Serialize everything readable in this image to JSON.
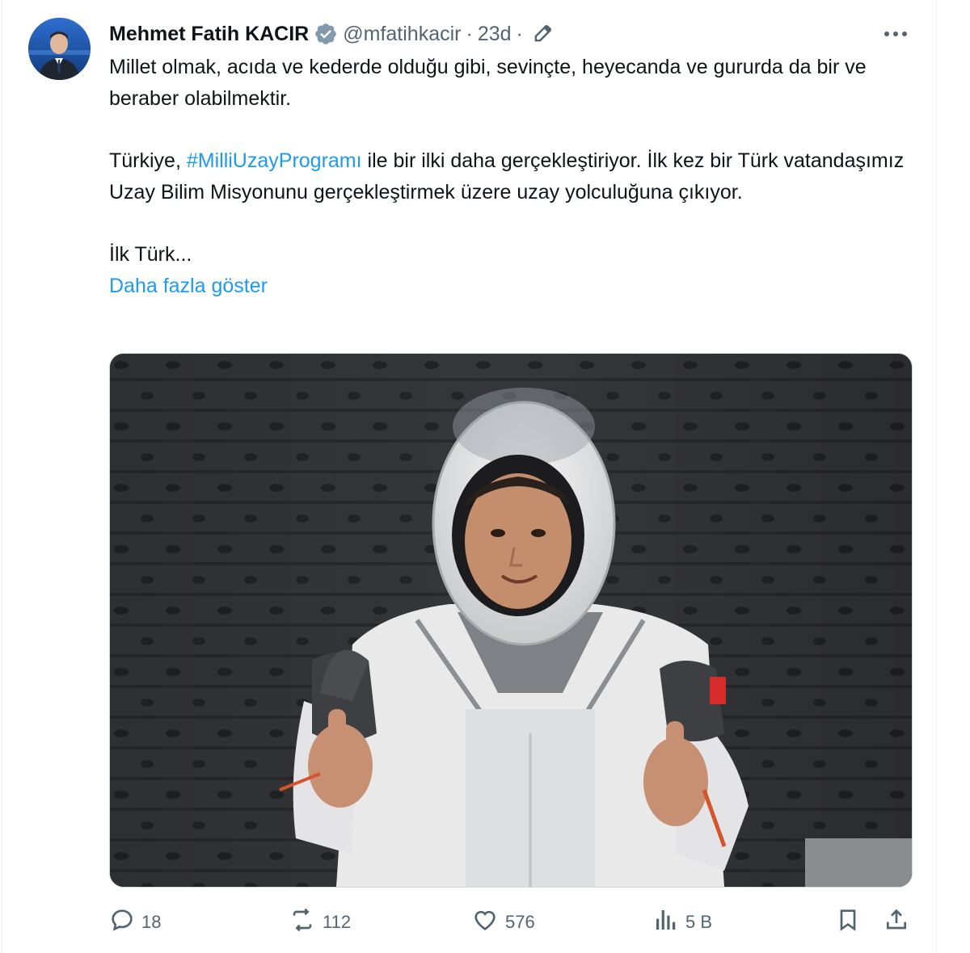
{
  "tweet": {
    "author_name": "Mehmet Fatih KACIR",
    "handle": "@mfatihkacir",
    "separator": "·",
    "time": "23d",
    "separator2": "·",
    "text_p1": "Millet olmak, acıda ve kederde olduğu gibi, sevinçte, heyecanda ve gururda da bir ve beraber olabilmektir.",
    "text_p2_before": "Türkiye, ",
    "hashtag": "#MilliUzayProgramı",
    "text_p2_after": " ile bir ilki daha gerçekleştiriyor. İlk kez bir Türk vatandaşımız Uzay Bilim Misyonunu gerçekleştirmek üzere uzay yolculuğuna çıkıyor.",
    "text_p3": "İlk Türk...",
    "show_more": "Daha fazla göster"
  },
  "actions": {
    "replies": "18",
    "reposts": "112",
    "likes": "576",
    "views": "5 B"
  },
  "icons": {
    "verified": "verified-badge-icon",
    "edited": "edited-pencil-icon",
    "more": "more-icon",
    "reply": "reply-icon",
    "repost": "repost-icon",
    "like": "heart-icon",
    "views": "views-chart-icon",
    "bookmark": "bookmark-icon",
    "share": "share-icon"
  },
  "colors": {
    "link": "#1d9bf0",
    "muted": "#536471",
    "text": "#0f1419"
  }
}
